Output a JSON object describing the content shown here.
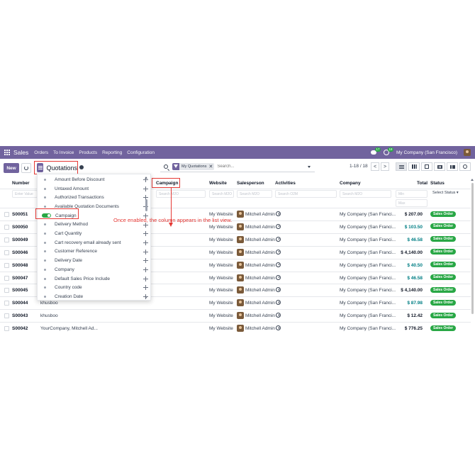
{
  "nav": {
    "app_name": "Sales",
    "menu": [
      "Orders",
      "To Invoice",
      "Products",
      "Reporting",
      "Configuration"
    ],
    "chat_badge": "17",
    "activity_badge": "18",
    "company": "My Company (San Francisco)"
  },
  "control": {
    "new_label": "New",
    "title": "Quotations",
    "facet_label": "My Quotations",
    "facet_remove": "✕",
    "search_placeholder": "Search...",
    "pager": "1-18 / 18",
    "prev": "<",
    "next": ">"
  },
  "columns": {
    "number": "Number",
    "campaign": "Campaign",
    "website": "Website",
    "salesperson": "Salesperson",
    "activities": "Activities",
    "company": "Company",
    "total": "Total",
    "status": "Status"
  },
  "filters": {
    "number": "Enter Value",
    "campaign": "Search M2O",
    "website": "Search M2O",
    "salesperson": "Search M2O",
    "activities": "Search O2M",
    "company": "Search M2O",
    "min": "Min",
    "max": "Max",
    "status": "Select Status ▾"
  },
  "dropdown": {
    "items": [
      "Amount Before Discount",
      "Untaxed Amount",
      "Authorized Transactions",
      "Available Quotation Documents",
      "Campaign",
      "Delivery Method",
      "Cart Quantity",
      "Cart recovery email already sent",
      "Customer Reference",
      "Delivery Date",
      "Company",
      "Default Sales Price Include",
      "Country code",
      "Creation Date"
    ]
  },
  "annotation": "Once enabled, the column appears in the list view.",
  "rows": [
    {
      "number": "S00051",
      "customer": "",
      "website": "My Website",
      "salesperson": "Mitchell Admin",
      "company": "My Company (San Franci...",
      "total": "$ 207.00",
      "total_blue": false,
      "status": "Sales Order"
    },
    {
      "number": "S00050",
      "customer": "",
      "website": "My Website",
      "salesperson": "Mitchell Admin",
      "company": "My Company (San Franci...",
      "total": "$ 103.50",
      "total_blue": true,
      "status": "Sales Order"
    },
    {
      "number": "S00049",
      "customer": "",
      "website": "My Website",
      "salesperson": "Mitchell Admin",
      "company": "My Company (San Franci...",
      "total": "$ 46.58",
      "total_blue": true,
      "status": "Sales Order"
    },
    {
      "number": "S00046",
      "customer": "",
      "website": "My Website",
      "salesperson": "Mitchell Admin",
      "company": "My Company (San Franci...",
      "total": "$ 4,140.00",
      "total_blue": false,
      "status": "Sales Order"
    },
    {
      "number": "S00048",
      "customer": "",
      "website": "My Website",
      "salesperson": "Mitchell Admin",
      "company": "My Company (San Franci...",
      "total": "$ 40.50",
      "total_blue": true,
      "status": "Sales Order"
    },
    {
      "number": "S00047",
      "customer": "",
      "website": "My Website",
      "salesperson": "Mitchell Admin",
      "company": "My Company (San Franci...",
      "total": "$ 46.58",
      "total_blue": true,
      "status": "Sales Order"
    },
    {
      "number": "S00045",
      "customer": "",
      "website": "My Website",
      "salesperson": "Mitchell Admin",
      "company": "My Company (San Franci...",
      "total": "$ 4,140.00",
      "total_blue": false,
      "status": "Sales Order"
    },
    {
      "number": "S00044",
      "customer": "khusboo",
      "website": "My Website",
      "salesperson": "Mitchell Admin",
      "company": "My Company (San Franci...",
      "total": "$ 87.98",
      "total_blue": true,
      "status": "Sales Order"
    },
    {
      "number": "S00043",
      "customer": "khusboo",
      "website": "My Website",
      "salesperson": "Mitchell Admin",
      "company": "My Company (San Franci...",
      "total": "$ 12.42",
      "total_blue": false,
      "status": "Sales Order"
    },
    {
      "number": "S00042",
      "customer": "YourCompany, Mitchell Ad...",
      "website": "My Website",
      "salesperson": "Mitchell Admin",
      "company": "My Company (San Franci...",
      "total": "$ 776.25",
      "total_blue": false,
      "status": "Sales Order"
    }
  ],
  "colors": {
    "brand": "#71639e",
    "success": "#28a745",
    "highlight": "#e53935",
    "link": "#017e84"
  }
}
